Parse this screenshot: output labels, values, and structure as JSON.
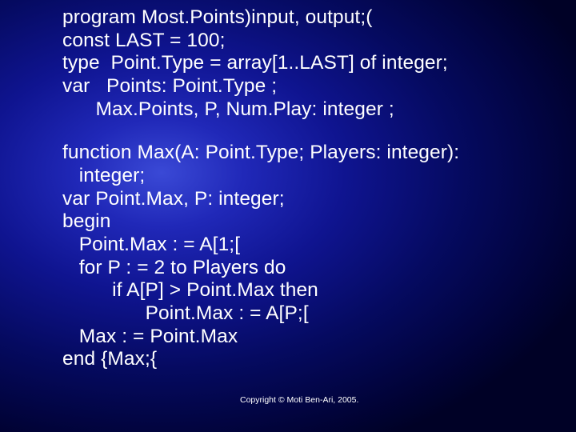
{
  "code": {
    "l1": "program Most.Points)input, output;(",
    "l2": "const LAST = 100;",
    "l3": "type  Point.Type = array[1..LAST] of integer;",
    "l4": "var   Points: Point.Type ;",
    "l5": "      Max.Points, P, Num.Play: integer ;",
    "l6": "function Max(A: Point.Type; Players: integer):",
    "l7": "   integer;",
    "l8": "var Point.Max, P: integer;",
    "l9": "begin",
    "l10": "   Point.Max : = A[1;[",
    "l11": "   for P : = 2 to Players do",
    "l12": "         if A[P] > Point.Max then",
    "l13": "               Point.Max : = A[P;[",
    "l14": "   Max : = Point.Max",
    "l15": "end {Max;{"
  },
  "copyright": "Copyright © Moti Ben-Ari, 2005."
}
